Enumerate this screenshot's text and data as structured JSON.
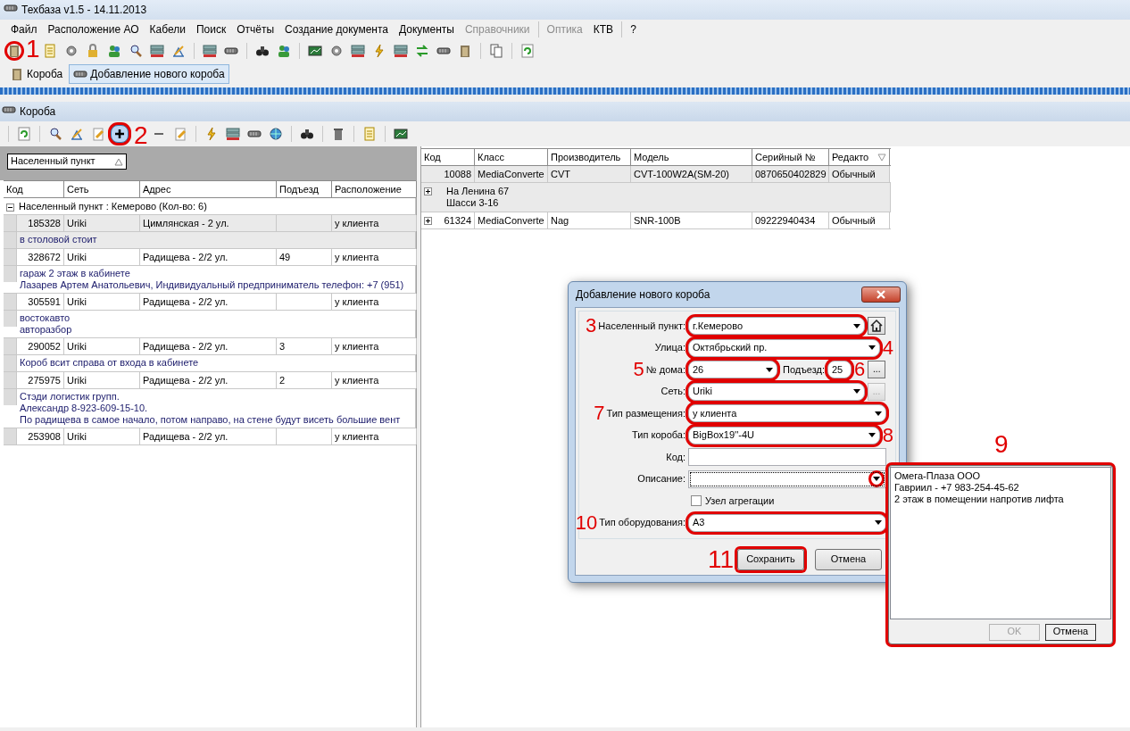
{
  "window": {
    "title": "Техбаза v1.5 - 14.11.2013"
  },
  "menu": [
    {
      "kind": "item",
      "label": "Файл",
      "disabled": false
    },
    {
      "kind": "item",
      "label": "Расположение АО",
      "disabled": false
    },
    {
      "kind": "item",
      "label": "Кабели",
      "disabled": false
    },
    {
      "kind": "item",
      "label": "Поиск",
      "disabled": false
    },
    {
      "kind": "item",
      "label": "Отчёты",
      "disabled": false
    },
    {
      "kind": "item",
      "label": "Создание документа",
      "disabled": false
    },
    {
      "kind": "item",
      "label": "Документы",
      "disabled": false
    },
    {
      "kind": "item",
      "label": "Справочники",
      "disabled": true
    },
    {
      "kind": "separator"
    },
    {
      "kind": "item",
      "label": "Оптика",
      "disabled": true
    },
    {
      "kind": "item",
      "label": "КТВ",
      "disabled": false
    },
    {
      "kind": "separator"
    },
    {
      "kind": "item",
      "label": "?",
      "disabled": false
    }
  ],
  "main_toolbar": {
    "annotation": "1"
  },
  "tabs": [
    {
      "label": "Короба",
      "selected": false
    },
    {
      "label": "Добавление нового короба",
      "selected": true
    }
  ],
  "panel": {
    "title": "Короба",
    "toolbar": {
      "add_pressed": true,
      "annotation": "2"
    }
  },
  "boxes_grid": {
    "group_by": "Населенный пункт",
    "columns": [
      "Код",
      "Сеть",
      "Адрес",
      "Подъезд",
      "Расположение"
    ],
    "group": {
      "label": "Населенный пункт : Кемерово (Кол-во: 6)",
      "expanded": true
    },
    "rows": [
      {
        "cells": [
          "185328",
          "Uriki",
          "Цимлянская - 2 ул.",
          "",
          "у клиента"
        ],
        "note": [
          "в столовой стоит"
        ],
        "selected": true
      },
      {
        "cells": [
          "328672",
          "Uriki",
          "Радищева - 2/2 ул.",
          "49",
          "у клиента"
        ],
        "note": [
          "гараж 2 этаж в кабинете",
          "Лазарев Артем Анатольевич, Индивидуальный предприниматель телефон: +7 (951)"
        ],
        "selected": false
      },
      {
        "cells": [
          "305591",
          "Uriki",
          "Радищева - 2/2 ул.",
          "",
          "у клиента"
        ],
        "note": [
          "востокавто",
          "авторазбор"
        ],
        "selected": false
      },
      {
        "cells": [
          "290052",
          "Uriki",
          "Радищева - 2/2 ул.",
          "3",
          "у клиента"
        ],
        "note": [
          "Короб всит справа от входа в кабинете"
        ],
        "selected": false
      },
      {
        "cells": [
          "275975",
          "Uriki",
          "Радищева - 2/2 ул.",
          "2",
          "у клиента"
        ],
        "note": [
          "Стэди логистик групп.",
          "Александр 8-923-609-15-10.",
          "По радищева в самое начало, потом направо, на стене будут висеть большие вент"
        ],
        "selected": false
      },
      {
        "cells": [
          "253908",
          "Uriki",
          "Радищева - 2/2 ул.",
          "",
          "у клиента"
        ],
        "selected": false
      }
    ]
  },
  "equipment_grid": {
    "columns": [
      "Код",
      "Класс",
      "Производитель",
      "Модель",
      "Серийный №",
      "Редакто"
    ],
    "rows": [
      {
        "cells": [
          "10088",
          "MediaConverte",
          "CVT",
          "CVT-100W2A(SM-20)",
          "0870650402829",
          "Обычный"
        ],
        "note": [
          "На Ленина 67",
          "Шасси 3-16"
        ],
        "selected": true,
        "expanded": false
      },
      {
        "cells": [
          "61324",
          "MediaConverte",
          "Nag",
          "SNR-100B",
          "09222940434",
          "Обычный"
        ],
        "selected": false,
        "expanded": false
      }
    ]
  },
  "dialog": {
    "title": "Добавление нового короба",
    "fields": [
      {
        "kind": "combo",
        "label": "Населенный пункт:",
        "value": "г.Кемерово",
        "ringed": true,
        "annotation": "3",
        "home_button": true
      },
      {
        "kind": "combo",
        "label": "Улица:",
        "value": "Октябрьский пр.",
        "ringed": true,
        "annotation": "4"
      },
      {
        "kind": "house",
        "label": "№ дома:",
        "value": "26",
        "ringed": true,
        "annotation": "5",
        "entrance": {
          "label": "Подъезд:",
          "value": "25",
          "annotation": "6"
        },
        "button": {
          "text": "...",
          "disabled": false
        }
      },
      {
        "kind": "combo",
        "label": "Сеть:",
        "value": "Uriki",
        "ringed": true,
        "button": {
          "text": "...",
          "disabled": true
        }
      },
      {
        "kind": "combo",
        "label": "Тип размещения:",
        "value": "у клиента",
        "ringed": true,
        "annotation": "7"
      },
      {
        "kind": "combo",
        "label": "Тип короба:",
        "value": "BigBox19''-4U",
        "ringed": true,
        "annotation": "8"
      },
      {
        "kind": "text",
        "label": "Код:",
        "ringed": false
      },
      {
        "kind": "memo",
        "label": "Описание:",
        "ringed": false,
        "focused": true,
        "arrow_ringed": true
      },
      {
        "kind": "checkbox",
        "label": "Узел агрегации",
        "checked": false
      },
      {
        "kind": "combo",
        "label": "Тип оборудования:",
        "value": "А3",
        "ringed": true,
        "annotation": "10"
      }
    ],
    "buttons": [
      {
        "label": "Сохранить",
        "annotation": "11"
      },
      {
        "label": "Отмена"
      }
    ]
  },
  "description_editor": {
    "annotation": "9",
    "lines": [
      "Омега-Плаза ООО",
      "Гавриил - +7 983-254-45-62",
      "2 этаж в помещении напротив лифта"
    ],
    "buttons": [
      {
        "label": "OK",
        "disabled": true
      },
      {
        "label": "Отмена",
        "disabled": false
      }
    ]
  }
}
